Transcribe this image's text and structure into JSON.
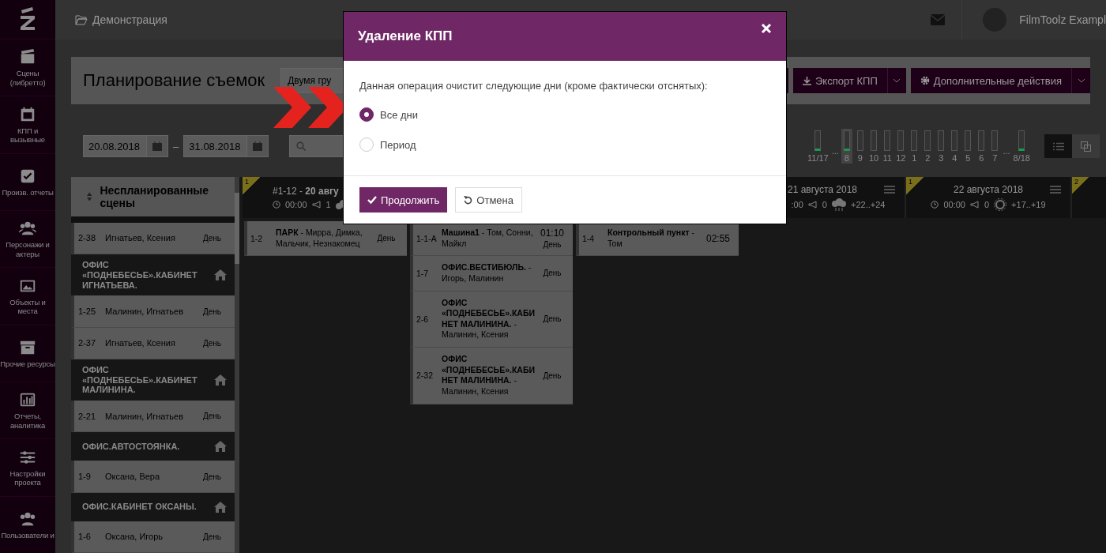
{
  "sidebar": {
    "items": [
      {
        "label": "Сцены (либретто)"
      },
      {
        "label": "КПП и вызывные"
      },
      {
        "label": "Произв. отчеты"
      },
      {
        "label": "Персонажи и актеры"
      },
      {
        "label": "Объекты и места"
      },
      {
        "label": "Прочие ресурсы"
      },
      {
        "label": "Отчеты, аналитика"
      },
      {
        "label": "Настройки проекта"
      },
      {
        "label": "Пользователи и"
      }
    ]
  },
  "topbar": {
    "project": "Демонстрация",
    "user": "FilmToolz Exampl"
  },
  "header": {
    "title": "Планирование съемок",
    "grouping": "Двумя гру",
    "buttons": [
      {
        "label": "Экспорт КПП",
        "kind": "export"
      },
      {
        "label": "Дополнительные действия",
        "kind": "settings"
      }
    ]
  },
  "toolbar": {
    "date_from": "20.08.2018",
    "date_separator": "–",
    "date_to": "31.08.2018",
    "days": [
      {
        "kind": "bar",
        "label": "11/17",
        "scheduled": true,
        "selected": false
      },
      {
        "kind": "gap",
        "label": "..."
      },
      {
        "kind": "bar",
        "label": "8",
        "scheduled": true,
        "selected": true
      },
      {
        "kind": "bar",
        "label": "9",
        "scheduled": false,
        "selected": false
      },
      {
        "kind": "bar",
        "label": "10",
        "scheduled": false,
        "selected": false
      },
      {
        "kind": "bar",
        "label": "11",
        "scheduled": false,
        "selected": false
      },
      {
        "kind": "bar",
        "label": "12",
        "scheduled": false,
        "selected": false
      },
      {
        "kind": "bar",
        "label": "1",
        "scheduled": false,
        "selected": false
      },
      {
        "kind": "bar",
        "label": "2",
        "scheduled": false,
        "selected": false
      },
      {
        "kind": "bar",
        "label": "3",
        "scheduled": false,
        "selected": false
      },
      {
        "kind": "bar",
        "label": "4",
        "scheduled": false,
        "selected": false
      },
      {
        "kind": "bar",
        "label": "5",
        "scheduled": false,
        "selected": false
      },
      {
        "kind": "bar",
        "label": "6",
        "scheduled": false,
        "selected": false
      },
      {
        "kind": "bar",
        "label": "7",
        "scheduled": false,
        "selected": false
      },
      {
        "kind": "gap",
        "label": "..."
      },
      {
        "kind": "bar",
        "label": "8/18",
        "scheduled": true,
        "selected": false
      }
    ],
    "views": [
      {
        "kind": "list",
        "selected": true
      },
      {
        "kind": "tiles",
        "selected": false
      }
    ]
  },
  "unplanned": {
    "title": "Неспланированные сцены",
    "items": [
      {
        "kind": "scene",
        "number": "2-38",
        "cast": "Игнатьев, Ксения",
        "time_of_day": "День"
      },
      {
        "kind": "location",
        "name": "ОФИС «ПОДНЕБЕСЬЕ».КАБИНЕТ ИГНАТЬЕВА."
      },
      {
        "kind": "scene",
        "number": "1-25",
        "cast": "Малинин, Игнатьев",
        "time_of_day": "День"
      },
      {
        "kind": "scene",
        "number": "2-37",
        "cast": "Игнатьев, Ксения",
        "time_of_day": "День"
      },
      {
        "kind": "location",
        "name": "ОФИС «ПОДНЕБЕСЬЕ».КАБИНЕТ МАЛИНИНА."
      },
      {
        "kind": "scene",
        "number": "2-21",
        "cast": "Малинин, Игнатьев",
        "time_of_day": "День"
      },
      {
        "kind": "location",
        "name": "ОФИС.АВТОСТОЯНКА."
      },
      {
        "kind": "scene",
        "number": "1-9",
        "cast": "Оксана, Вера",
        "time_of_day": "День"
      },
      {
        "kind": "location",
        "name": "ОФИС.КАБИНЕТ ОКСАНЫ."
      },
      {
        "kind": "scene",
        "number": "1-6",
        "cast": "Оксана, Игорь",
        "time_of_day": "День"
      }
    ]
  },
  "days": [
    {
      "badge": "1",
      "title": "#1-12 - **20 авгу**",
      "time": "00:00",
      "calls": "1",
      "scenes": [
        {
          "number": "1-2",
          "description": "**ПАРК** - Мирра, Димка, Мальчик, Незнакомец",
          "time_of_day": "День"
        }
      ]
    },
    {
      "scenes": [
        {
          "number": "1-1-А",
          "description": "**Машина1** - Том, Сонни, Майкл",
          "duration": "01:10",
          "time_of_day": "День"
        },
        {
          "number": "1-7",
          "description": "**ОФИС.ВЕСТИБЮЛЬ.** - Игорь, Малинин",
          "time_of_day": "День"
        },
        {
          "number": "2-6",
          "description": "**ОФИС «ПОДНЕБЕСЬЕ».КАБИНЕТ МАЛИНИНА.** - Малинин, Ксения",
          "time_of_day": "День"
        },
        {
          "number": "2-32",
          "description": "**ОФИС «ПОДНЕБЕСЬЕ».КАБИНЕТ МАЛИНИНА.** - Малинин, Ксения",
          "time_of_day": "День"
        }
      ]
    },
    {
      "scenes": [
        {
          "number": "1-4",
          "description": "**Контрольный пункт** - Том",
          "duration": "02:55"
        }
      ]
    },
    {
      "title": "21 августа 2018",
      "time": ":00",
      "calls": "0",
      "temperature": "+22..+24"
    },
    {
      "badge": "1",
      "title": "22 августа 2018",
      "time": "00:00",
      "calls": "0",
      "temperature": "+17..+19"
    },
    {
      "badge": "2"
    }
  ],
  "modal": {
    "title": "Удаление КПП",
    "message": "Данная операция очистит следующие дни (кроме фактически отснятых):",
    "options": [
      {
        "label": "Все дни",
        "selected": true
      },
      {
        "label": "Период",
        "selected": false
      }
    ],
    "buttons": [
      {
        "label": "Продолжить",
        "kind": "primary"
      },
      {
        "label": "Отмена",
        "kind": "cancel"
      }
    ]
  }
}
